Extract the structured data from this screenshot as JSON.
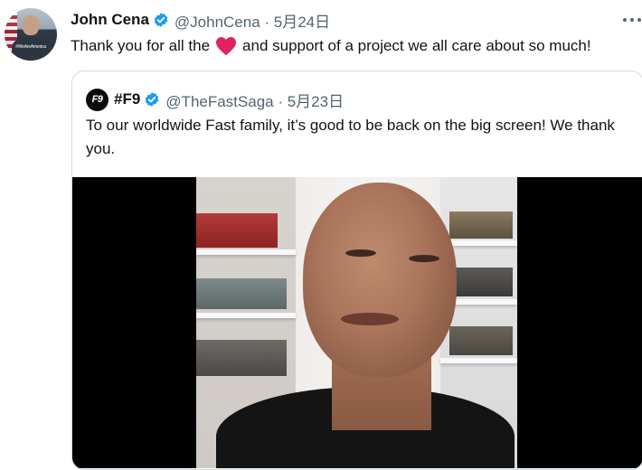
{
  "tweet": {
    "author_name": "John Cena",
    "author_handle_date": "@JohnCena · 5月24日",
    "text_before": "Thank you for all the",
    "text_after": "and support of a project we all care about so much!",
    "avatar_text": "#WeAreAmerica",
    "heart_color": "#e0245e",
    "verified_color": "#1d9bf0"
  },
  "quoted": {
    "logo_text": "F9",
    "author_name": "#F9",
    "author_handle_date": "@TheFastSaga · 5月23日",
    "text": "To our worldwide Fast family, it’s good to be back on the big screen! We thank you."
  },
  "icons": {
    "more": "more-horizontal-icon",
    "verified": "verified-badge-icon",
    "heart": "heart-emoji-icon"
  }
}
